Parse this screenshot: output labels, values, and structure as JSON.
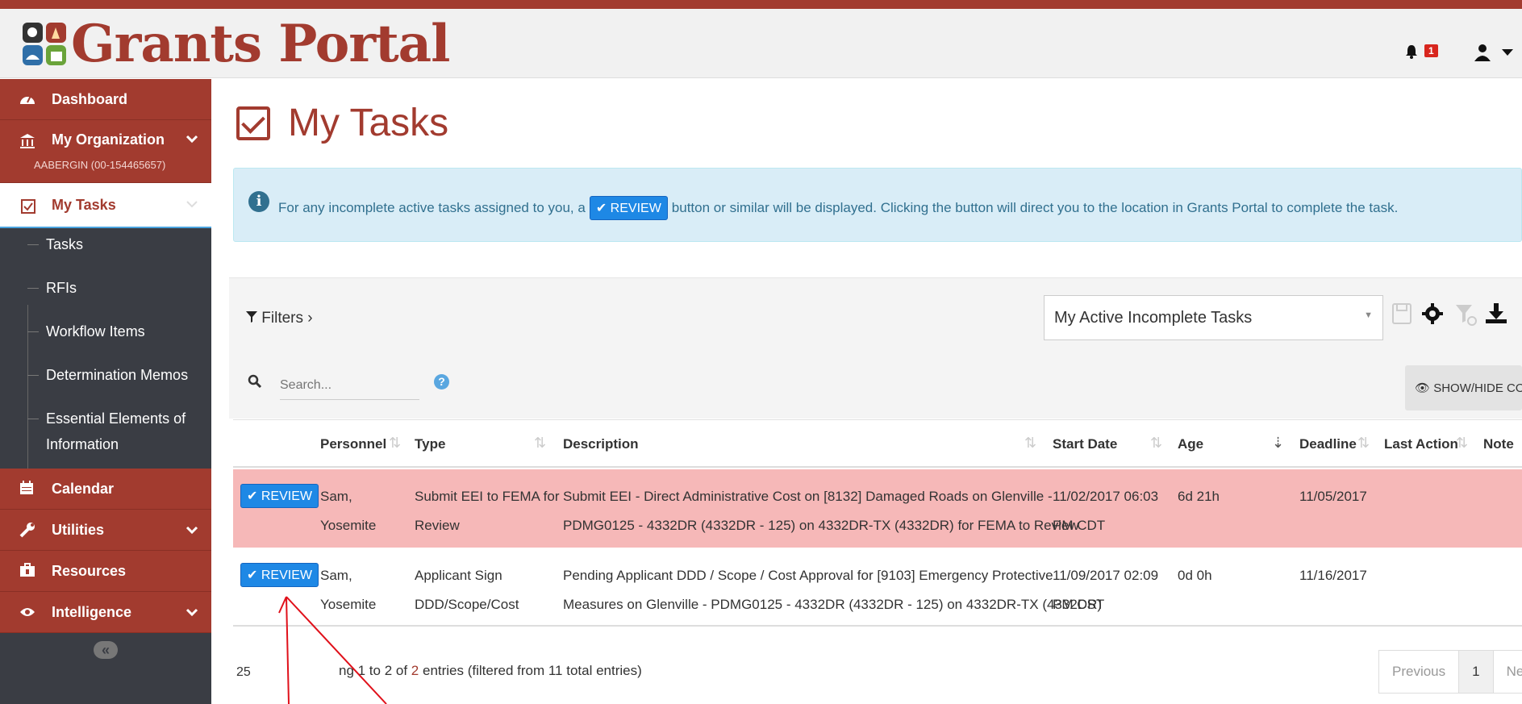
{
  "app": {
    "title": "Grants Portal"
  },
  "header": {
    "notification_count": "1"
  },
  "sidebar": {
    "dashboard": "Dashboard",
    "my_org": "My Organization",
    "org_id": "AABERGIN (00-154465657)",
    "my_tasks": "My Tasks",
    "subitems": [
      "Tasks",
      "RFIs",
      "Workflow Items",
      "Determination Memos",
      "Essential Elements of",
      "Information"
    ],
    "calendar": "Calendar",
    "utilities": "Utilities",
    "resources": "Resources",
    "intelligence": "Intelligence",
    "collapse": "«"
  },
  "page": {
    "title": "My Tasks"
  },
  "info": {
    "before": "For any incomplete active tasks assigned to you, a",
    "button": "REVIEW",
    "after": "button or similar will be displayed. Clicking the button will direct you to the location in Grants Portal to complete the task."
  },
  "toolbar": {
    "filters": "Filters",
    "view": "My Active Incomplete Tasks",
    "search_placeholder": "Search...",
    "show_hide": "SHOW/HIDE COLUMNS"
  },
  "table": {
    "headers": [
      "Personnel",
      "Type",
      "Description",
      "Start Date",
      "Age",
      "Deadline",
      "Last Action",
      "Note"
    ],
    "rows": [
      {
        "action": "REVIEW",
        "personnel_1": "Sam,",
        "personnel_2": "Yosemite",
        "type_1": "Submit EEI to FEMA for",
        "type_2": "Review",
        "desc_1": "Submit EEI - Direct Administrative Cost on [8132] Damaged Roads on Glenville -",
        "desc_2": "PDMG0125 - 4332DR (4332DR - 125) on 4332DR-TX (4332DR) for FEMA to Review",
        "start_1": "11/02/2017 06:03",
        "start_2": "PM CDT",
        "age": "6d 21h",
        "deadline": "11/05/2017"
      },
      {
        "action": "REVIEW",
        "personnel_1": "Sam,",
        "personnel_2": "Yosemite",
        "type_1": "Applicant Sign",
        "type_2": "DDD/Scope/Cost",
        "desc_1": "Pending Applicant DDD / Scope / Cost Approval for [9103] Emergency Protective",
        "desc_2": "Measures on Glenville - PDMG0125 - 4332DR (4332DR - 125) on 4332DR-TX (4332DR)",
        "start_1": "11/09/2017 02:09",
        "start_2": "PM CST",
        "age": "0d 0h",
        "deadline": "11/16/2017"
      }
    ]
  },
  "footer": {
    "page_size": "25",
    "info_pre": "ng 1 to 2 of ",
    "info_count": "2",
    "info_post": " entries (filtered from 11 total entries)",
    "prev": "Previous",
    "page": "1",
    "next": "Ne"
  },
  "colors": {
    "brand": "#a23b2f",
    "info_bg": "#d9edf7",
    "row_highlight": "#f6b8b8",
    "review_button": "#1e88e5",
    "annotation": "#e0101a"
  }
}
